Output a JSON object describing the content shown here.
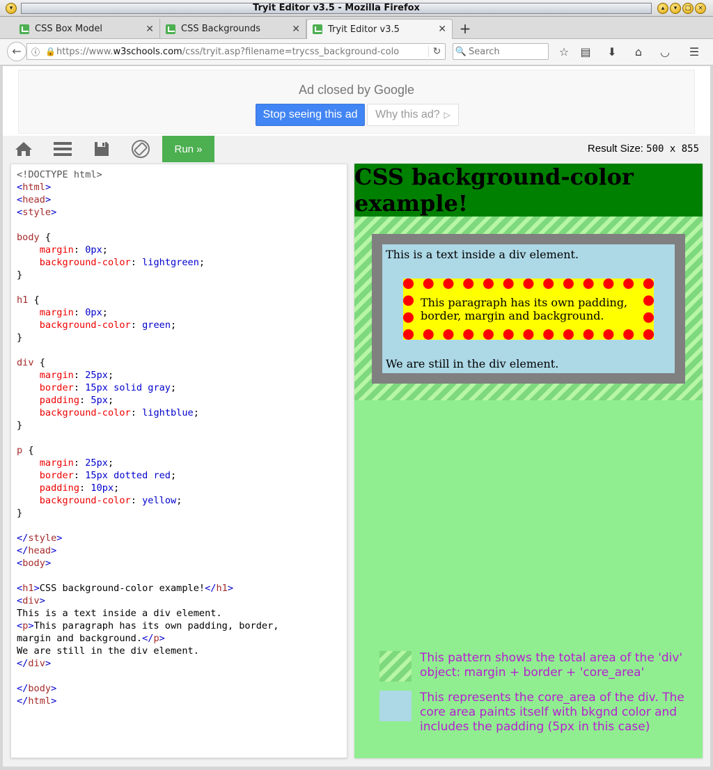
{
  "window": {
    "title": "Tryit Editor v3.5 - Mozilla Firefox"
  },
  "tabs": [
    {
      "label": "CSS Box Model",
      "active": false
    },
    {
      "label": "CSS Backgrounds",
      "active": false
    },
    {
      "label": "Tryit Editor v3.5",
      "active": true
    }
  ],
  "nav": {
    "url_prefix": "https://www.",
    "url_host": "w3schools.com",
    "url_path": "/css/tryit.asp?filename=trycss_background-colo",
    "search_placeholder": "Search"
  },
  "ad": {
    "title": "Ad closed by Google",
    "stop_label": "Stop seeing this ad",
    "why_label": "Why this ad?"
  },
  "toolbar": {
    "run_label": "Run »",
    "result_size_label": "Result Size:",
    "result_size_value": "500 x 855"
  },
  "colors": {
    "run_green": "#4caf50",
    "ad_blue": "#4285f4",
    "legend_magenta": "#b520d0"
  },
  "code_lines": [
    [
      {
        "t": "doc",
        "s": "<!DOCTYPE html>"
      }
    ],
    [
      {
        "t": "br",
        "s": "<"
      },
      {
        "t": "tag",
        "s": "html"
      },
      {
        "t": "br",
        "s": ">"
      }
    ],
    [
      {
        "t": "br",
        "s": "<"
      },
      {
        "t": "tag",
        "s": "head"
      },
      {
        "t": "br",
        "s": ">"
      }
    ],
    [
      {
        "t": "br",
        "s": "<"
      },
      {
        "t": "tag",
        "s": "style"
      },
      {
        "t": "br",
        "s": ">"
      }
    ],
    [],
    [
      {
        "t": "sel",
        "s": "body"
      },
      {
        "t": "txt",
        "s": " {"
      }
    ],
    [
      {
        "t": "txt",
        "s": "    "
      },
      {
        "t": "prop",
        "s": "margin"
      },
      {
        "t": "txt",
        "s": ": "
      },
      {
        "t": "val",
        "s": "0px"
      },
      {
        "t": "txt",
        "s": ";"
      }
    ],
    [
      {
        "t": "txt",
        "s": "    "
      },
      {
        "t": "prop",
        "s": "background-color"
      },
      {
        "t": "txt",
        "s": ": "
      },
      {
        "t": "val",
        "s": "lightgreen"
      },
      {
        "t": "txt",
        "s": ";"
      }
    ],
    [
      {
        "t": "txt",
        "s": "}"
      }
    ],
    [],
    [
      {
        "t": "sel",
        "s": "h1"
      },
      {
        "t": "txt",
        "s": " {"
      }
    ],
    [
      {
        "t": "txt",
        "s": "    "
      },
      {
        "t": "prop",
        "s": "margin"
      },
      {
        "t": "txt",
        "s": ": "
      },
      {
        "t": "val",
        "s": "0px"
      },
      {
        "t": "txt",
        "s": ";"
      }
    ],
    [
      {
        "t": "txt",
        "s": "    "
      },
      {
        "t": "prop",
        "s": "background-color"
      },
      {
        "t": "txt",
        "s": ": "
      },
      {
        "t": "val",
        "s": "green"
      },
      {
        "t": "txt",
        "s": ";"
      }
    ],
    [
      {
        "t": "txt",
        "s": "}"
      }
    ],
    [],
    [
      {
        "t": "sel",
        "s": "div"
      },
      {
        "t": "txt",
        "s": " {"
      }
    ],
    [
      {
        "t": "txt",
        "s": "    "
      },
      {
        "t": "prop",
        "s": "margin"
      },
      {
        "t": "txt",
        "s": ": "
      },
      {
        "t": "val",
        "s": "25px"
      },
      {
        "t": "txt",
        "s": ";"
      }
    ],
    [
      {
        "t": "txt",
        "s": "    "
      },
      {
        "t": "prop",
        "s": "border"
      },
      {
        "t": "txt",
        "s": ": "
      },
      {
        "t": "val",
        "s": "15px solid gray"
      },
      {
        "t": "txt",
        "s": ";"
      }
    ],
    [
      {
        "t": "txt",
        "s": "    "
      },
      {
        "t": "prop",
        "s": "padding"
      },
      {
        "t": "txt",
        "s": ": "
      },
      {
        "t": "val",
        "s": "5px"
      },
      {
        "t": "txt",
        "s": ";"
      }
    ],
    [
      {
        "t": "txt",
        "s": "    "
      },
      {
        "t": "prop",
        "s": "background-color"
      },
      {
        "t": "txt",
        "s": ": "
      },
      {
        "t": "val",
        "s": "lightblue"
      },
      {
        "t": "txt",
        "s": ";"
      }
    ],
    [
      {
        "t": "txt",
        "s": "}"
      }
    ],
    [],
    [
      {
        "t": "sel",
        "s": "p"
      },
      {
        "t": "txt",
        "s": " {"
      }
    ],
    [
      {
        "t": "txt",
        "s": "    "
      },
      {
        "t": "prop",
        "s": "margin"
      },
      {
        "t": "txt",
        "s": ": "
      },
      {
        "t": "val",
        "s": "25px"
      },
      {
        "t": "txt",
        "s": ";"
      }
    ],
    [
      {
        "t": "txt",
        "s": "    "
      },
      {
        "t": "prop",
        "s": "border"
      },
      {
        "t": "txt",
        "s": ": "
      },
      {
        "t": "val",
        "s": "15px dotted red"
      },
      {
        "t": "txt",
        "s": ";"
      }
    ],
    [
      {
        "t": "txt",
        "s": "    "
      },
      {
        "t": "prop",
        "s": "padding"
      },
      {
        "t": "txt",
        "s": ": "
      },
      {
        "t": "val",
        "s": "10px"
      },
      {
        "t": "txt",
        "s": ";"
      }
    ],
    [
      {
        "t": "txt",
        "s": "    "
      },
      {
        "t": "prop",
        "s": "background-color"
      },
      {
        "t": "txt",
        "s": ": "
      },
      {
        "t": "val",
        "s": "yellow"
      },
      {
        "t": "txt",
        "s": ";"
      }
    ],
    [
      {
        "t": "txt",
        "s": "}"
      }
    ],
    [],
    [
      {
        "t": "br",
        "s": "</"
      },
      {
        "t": "tag",
        "s": "style"
      },
      {
        "t": "br",
        "s": ">"
      }
    ],
    [
      {
        "t": "br",
        "s": "</"
      },
      {
        "t": "tag",
        "s": "head"
      },
      {
        "t": "br",
        "s": ">"
      }
    ],
    [
      {
        "t": "br",
        "s": "<"
      },
      {
        "t": "tag",
        "s": "body"
      },
      {
        "t": "br",
        "s": ">"
      }
    ],
    [],
    [
      {
        "t": "br",
        "s": "<"
      },
      {
        "t": "tag",
        "s": "h1"
      },
      {
        "t": "br",
        "s": ">"
      },
      {
        "t": "txt",
        "s": "CSS background-color example!"
      },
      {
        "t": "br",
        "s": "</"
      },
      {
        "t": "tag",
        "s": "h1"
      },
      {
        "t": "br",
        "s": ">"
      }
    ],
    [
      {
        "t": "br",
        "s": "<"
      },
      {
        "t": "tag",
        "s": "div"
      },
      {
        "t": "br",
        "s": ">"
      }
    ],
    [
      {
        "t": "txt",
        "s": "This is a text inside a div element."
      }
    ],
    [
      {
        "t": "br",
        "s": "<"
      },
      {
        "t": "tag",
        "s": "p"
      },
      {
        "t": "br",
        "s": ">"
      },
      {
        "t": "txt",
        "s": "This paragraph has its own padding, border,"
      }
    ],
    [
      {
        "t": "txt",
        "s": "margin and background."
      },
      {
        "t": "br",
        "s": "</"
      },
      {
        "t": "tag",
        "s": "p"
      },
      {
        "t": "br",
        "s": ">"
      }
    ],
    [
      {
        "t": "txt",
        "s": "We are still in the div element."
      }
    ],
    [
      {
        "t": "br",
        "s": "</"
      },
      {
        "t": "tag",
        "s": "div"
      },
      {
        "t": "br",
        "s": ">"
      }
    ],
    [],
    [
      {
        "t": "br",
        "s": "</"
      },
      {
        "t": "tag",
        "s": "body"
      },
      {
        "t": "br",
        "s": ">"
      }
    ],
    [
      {
        "t": "br",
        "s": "</"
      },
      {
        "t": "tag",
        "s": "html"
      },
      {
        "t": "br",
        "s": ">"
      }
    ]
  ],
  "result": {
    "h1": "CSS background-color example!",
    "div_text_top": "This is a text inside a div element.",
    "p_text": "This paragraph has its own padding, border, margin and background.",
    "div_text_bottom": "We are still in the div element.",
    "legend": [
      {
        "swatch": "div-total-area-pattern",
        "text": "This pattern shows the total area of the 'div' object:  margin + border + 'core_area'"
      },
      {
        "swatch": "core-area-lightblue",
        "text": "This represents the core_area of the div. The core area paints itself with bkgnd color and includes the padding (5px in this case)"
      }
    ]
  }
}
